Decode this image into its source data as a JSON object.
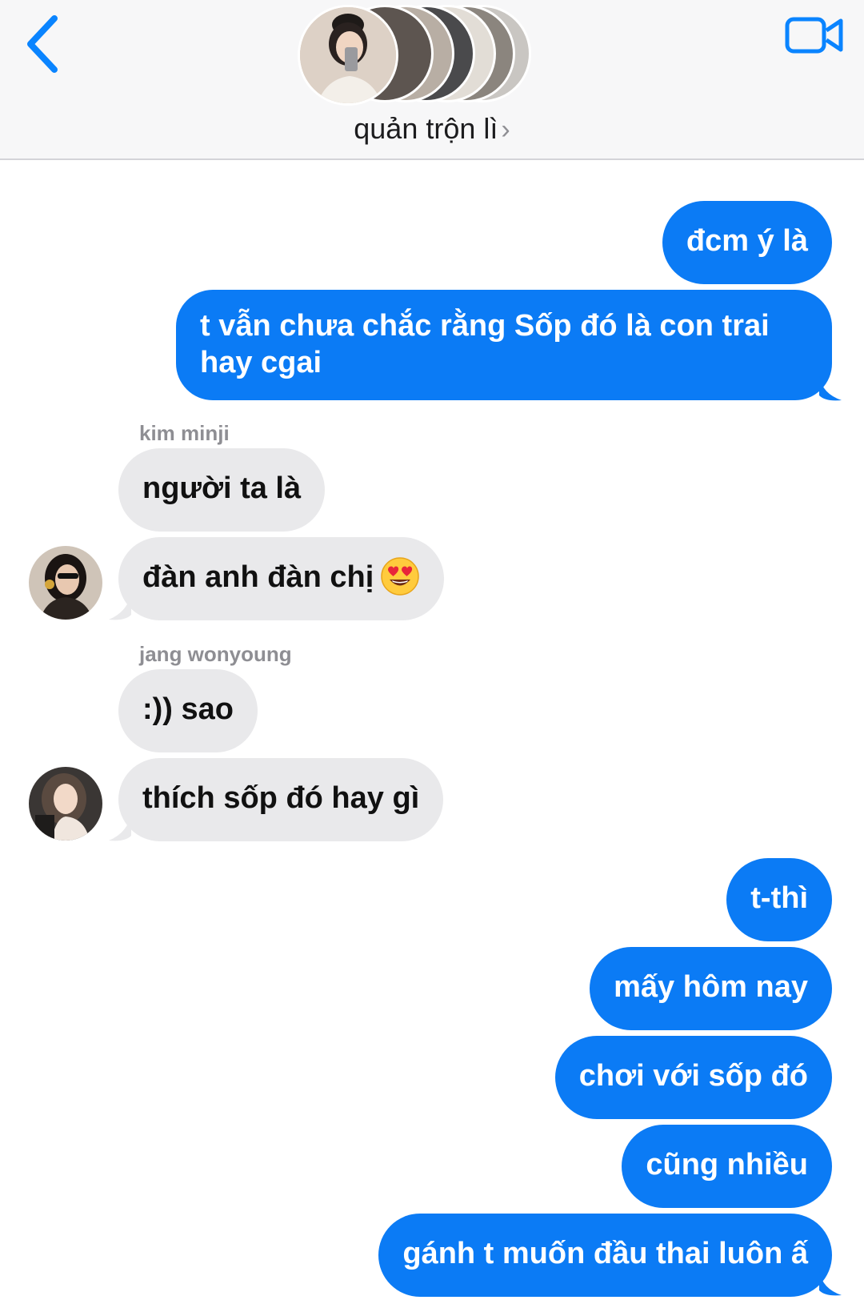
{
  "header": {
    "group_name": "quản trộn lì",
    "chevron": "›",
    "back_icon": "chevron-left-icon",
    "video_icon": "video-camera-icon"
  },
  "messages": [
    {
      "side": "outgoing",
      "text": "đcm ý là"
    },
    {
      "side": "outgoing",
      "text": "t vẫn chưa chắc rằng Sốp đó là con trai hay cgai"
    },
    {
      "side": "incoming",
      "sender": "kim minji",
      "text": "người ta là"
    },
    {
      "side": "incoming",
      "sender": "kim minji",
      "text": "đàn anh đàn chị",
      "emoji": "smiling-face-with-heart-eyes"
    },
    {
      "side": "incoming",
      "sender": "jang wonyoung",
      "text": ":)) sao"
    },
    {
      "side": "incoming",
      "sender": "jang wonyoung",
      "text": "thích sốp đó hay gì"
    },
    {
      "side": "outgoing",
      "text": "t-thì"
    },
    {
      "side": "outgoing",
      "text": "mấy hôm nay"
    },
    {
      "side": "outgoing",
      "text": "chơi với sốp đó"
    },
    {
      "side": "outgoing",
      "text": "cũng nhiều"
    },
    {
      "side": "outgoing",
      "text": "gánh t muốn đầu thai luôn ấ"
    }
  ],
  "colors": {
    "outgoing_bubble": "#0b7bf5",
    "incoming_bubble": "#e9e9eb",
    "accent": "#0a84ff",
    "header_bg": "#f7f7f8"
  }
}
